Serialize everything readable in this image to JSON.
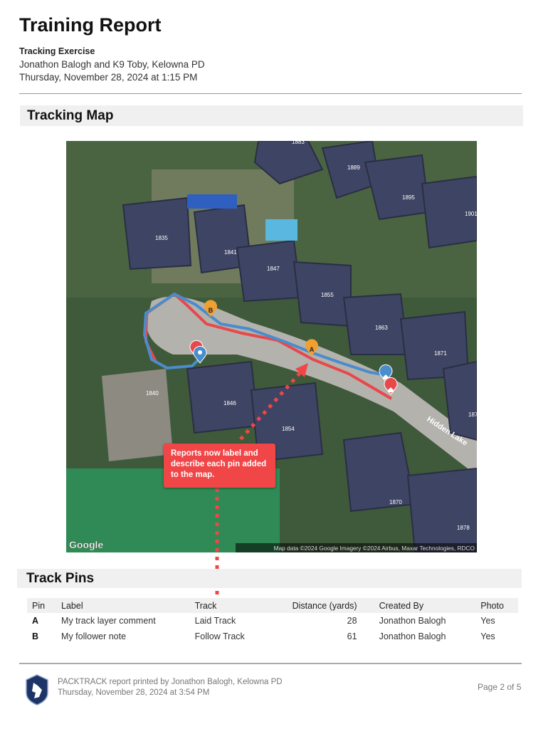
{
  "header": {
    "title": "Training Report",
    "subtitle": "Tracking Exercise",
    "handler": "Jonathon Balogh and K9 Toby, Kelowna PD",
    "date": "Thursday, November 28, 2024 at 1:15 PM"
  },
  "map_section": {
    "title": "Tracking Map",
    "google_logo": "Google",
    "attribution": "Map data ©2024 Google Imagery ©2024 Airbus, Maxar Technologies, RDCO",
    "street_label": "Hidden Lake",
    "house_numbers": [
      "1883",
      "1889",
      "1895",
      "1901",
      "1835",
      "1841",
      "1847",
      "1855",
      "1863",
      "1871",
      "1879",
      "1840",
      "1846",
      "1854",
      "1870",
      "1878"
    ],
    "pins": [
      {
        "letter": "B",
        "color": "#f0a030"
      },
      {
        "letter": "A",
        "color": "#f0a030"
      }
    ],
    "track_colors": {
      "laid": "#e8484a",
      "follow": "#4a8ccc"
    },
    "callout": "Reports now label and describe each pin added to the map."
  },
  "pins_section": {
    "title": "Track Pins",
    "columns": [
      "Pin",
      "Label",
      "Track",
      "Distance (yards)",
      "Created By",
      "Photo"
    ],
    "rows": [
      {
        "pin": "A",
        "label": "My track layer comment",
        "track": "Laid Track",
        "distance": "28",
        "created_by": "Jonathon Balogh",
        "photo": "Yes"
      },
      {
        "pin": "B",
        "label": "My follower note",
        "track": "Follow Track",
        "distance": "61",
        "created_by": "Jonathon Balogh",
        "photo": "Yes"
      }
    ]
  },
  "footer": {
    "printed_by": "PACKTRACK report printed by Jonathon Balogh, Kelowna PD",
    "printed_date": "Thursday, November 28, 2024 at 3:54 PM",
    "page": "Page 2 of 5"
  }
}
